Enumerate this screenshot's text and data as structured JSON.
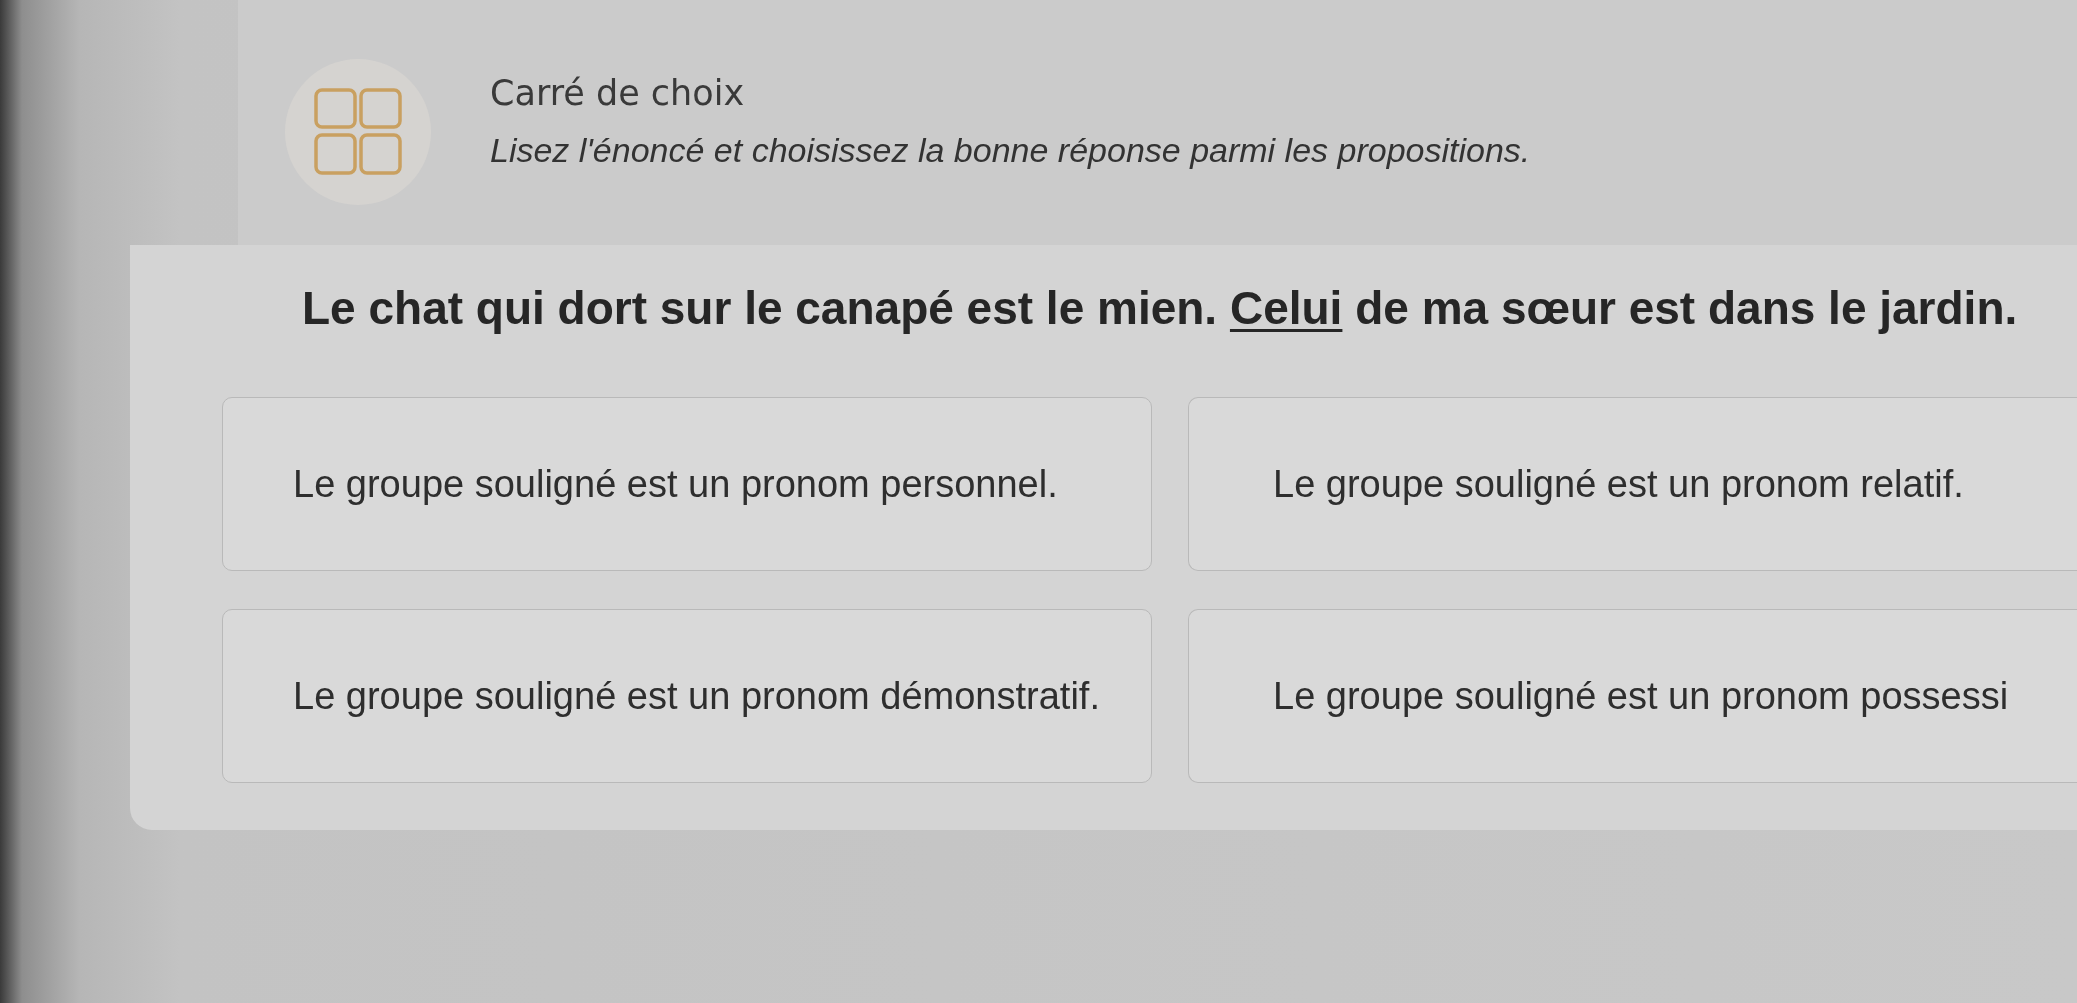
{
  "header": {
    "title": "Carré de choix",
    "instructions": "Lisez l'énoncé et choisissez la bonne réponse parmi les propositions."
  },
  "statement": [
    {
      "text": "Le chat qui dort sur le canapé est le mien.",
      "underlined": false
    },
    {
      "text": "Celui",
      "underlined": true
    },
    {
      "text": "de ma sœur est dans le jardin.",
      "underlined": false
    }
  ],
  "options": [
    {
      "text": "Le groupe souligné est un pronom personnel.",
      "selected": false
    },
    {
      "text": "Le groupe souligné est un pronom relatif.",
      "selected": false
    },
    {
      "text": "Le groupe souligné est un pronom démonstratif.",
      "selected": false
    },
    {
      "text": "Le groupe souligné est un pronom possessi",
      "selected": false
    }
  ]
}
